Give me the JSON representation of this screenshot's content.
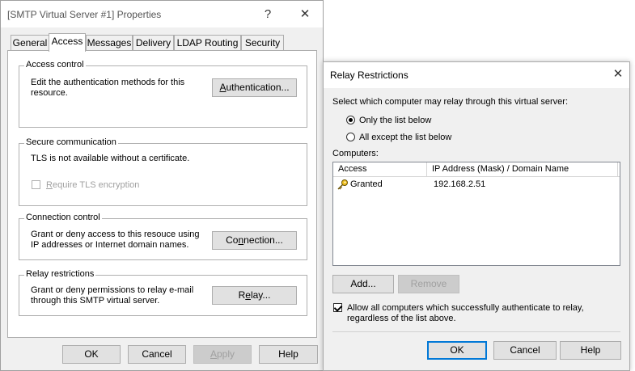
{
  "main_dialog": {
    "title": "[SMTP Virtual Server #1] Properties",
    "help_glyph": "?",
    "close_glyph": "✕",
    "tabs": [
      {
        "label": "General",
        "active": false
      },
      {
        "label": "Access",
        "active": true
      },
      {
        "label": "Messages",
        "active": false
      },
      {
        "label": "Delivery",
        "active": false
      },
      {
        "label": "LDAP Routing",
        "active": false
      },
      {
        "label": "Security",
        "active": false
      }
    ],
    "access_control": {
      "label": "Access control",
      "text": "Edit the authentication methods for this resource.",
      "button": {
        "mnemonic": "A",
        "rest": "uthentication..."
      }
    },
    "secure_communication": {
      "label": "Secure communication",
      "text": "TLS is not available without a certificate.",
      "checkbox": {
        "mnemonic": "R",
        "rest": "equire TLS encryption",
        "checked": false,
        "enabled": false
      }
    },
    "connection_control": {
      "label": "Connection control",
      "text": "Grant or deny access to this resouce using IP addresses or Internet domain names.",
      "button": {
        "pre": "Co",
        "mnemonic": "n",
        "rest": "nection..."
      }
    },
    "relay_restrictions": {
      "label": "Relay restrictions",
      "text": "Grant or deny permissions to relay e-mail through this SMTP virtual server.",
      "button": {
        "pre": "R",
        "mnemonic": "e",
        "rest": "lay..."
      }
    },
    "footer": {
      "ok": "OK",
      "cancel": "Cancel",
      "apply": {
        "mnemonic": "A",
        "rest": "pply"
      },
      "help": "Help"
    }
  },
  "relay_dialog": {
    "title": "Relay Restrictions",
    "close_glyph": "✕",
    "instruction": "Select which computer may relay through this virtual server:",
    "options": [
      {
        "label": "Only the list below",
        "checked": true
      },
      {
        "label": "All except the list below",
        "checked": false
      }
    ],
    "computers_label": "Computers:",
    "columns": [
      "Access",
      "IP Address (Mask) / Domain Name"
    ],
    "rows": [
      {
        "access": "Granted",
        "address": "192.168.2.51",
        "icon": "key-icon"
      }
    ],
    "add_button": "Add...",
    "remove_button": "Remove",
    "allow_authenticated": {
      "label": "Allow all computers which successfully authenticate to relay, regardless of the list above.",
      "checked": true
    },
    "footer": {
      "ok": "OK",
      "cancel": "Cancel",
      "help": "Help"
    }
  }
}
